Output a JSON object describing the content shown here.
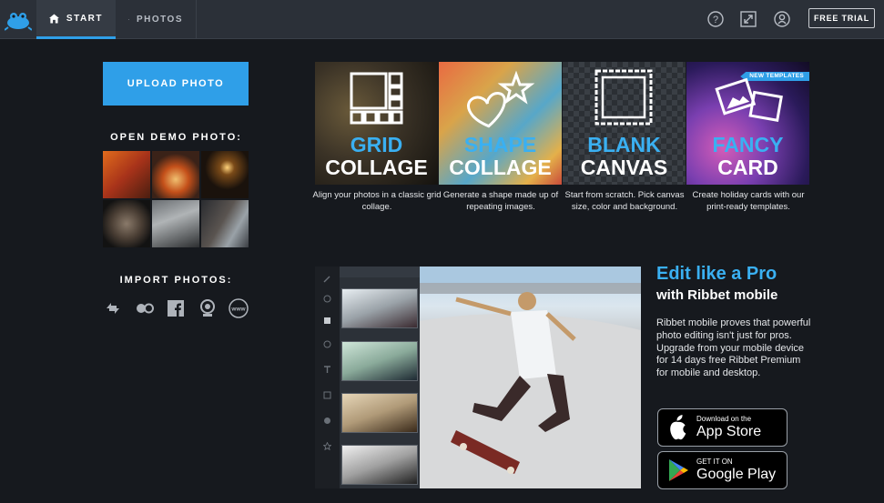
{
  "nav": {
    "tabs": [
      {
        "label": "START",
        "icon": "home-icon",
        "active": true
      },
      {
        "label": "PHOTOS",
        "icon": "image-icon",
        "active": false
      }
    ],
    "free_trial_label": "FREE TRIAL",
    "icons": [
      "help-icon",
      "fullscreen-icon",
      "account-icon"
    ]
  },
  "sidebar": {
    "upload_label": "UPLOAD PHOTO",
    "demo_label": "OPEN DEMO PHOTO:",
    "import_label": "IMPORT PHOTOS:",
    "import_sources": [
      "reload-icon",
      "flickr-icon",
      "facebook-icon",
      "webcam-icon",
      "web-url-icon"
    ],
    "import_web_text": "www"
  },
  "cards": [
    {
      "line1": "GRID",
      "line2": "COLLAGE",
      "desc": "Align your photos in a classic grid collage."
    },
    {
      "line1": "SHAPE",
      "line2": "COLLAGE",
      "desc": "Generate a shape made up of repeating images."
    },
    {
      "line1": "BLANK",
      "line2": "CANVAS",
      "desc": "Start from scratch. Pick canvas size, color and background."
    },
    {
      "line1": "FANCY",
      "line2": "CARD",
      "desc": "Create holiday cards with our print-ready templates.",
      "badge": "NEW TEMPLATES"
    }
  ],
  "promo": {
    "title": "Edit like a Pro",
    "subtitle": "with Ribbet mobile",
    "body": "Ribbet mobile proves that powerful photo editing isn't just for pros. Upgrade from your mobile device for 14 days free Ribbet Premium for mobile and desktop.",
    "app_store": {
      "small": "Download on the",
      "big": "App Store"
    },
    "google_play": {
      "small": "GET IT ON",
      "big": "Google Play"
    }
  },
  "colors": {
    "accent": "#2f9fe8",
    "background": "#16191e",
    "topbar": "#2b3038"
  }
}
